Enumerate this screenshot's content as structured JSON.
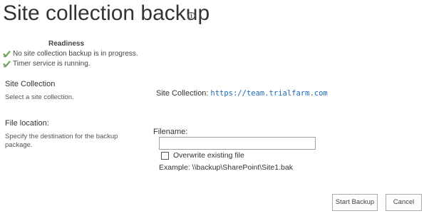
{
  "page": {
    "title": "Site collection backup",
    "info_icon": "info-icon"
  },
  "readiness": {
    "heading": "Readiness",
    "items": [
      {
        "icon": "check-icon",
        "text": "No site collection backup is in progress."
      },
      {
        "icon": "check-icon",
        "text": "Timer service is running."
      }
    ]
  },
  "site_collection": {
    "title": "Site Collection",
    "description": "Select a site collection.",
    "label": "Site Collection:",
    "value": "https://team.trialfarm.com"
  },
  "file_location": {
    "title": "File location:",
    "description_line1": "Specify the destination for the backup",
    "description_line2": "package.",
    "filename_label": "Filename:",
    "filename_value": "",
    "overwrite_label": "Overwrite existing file",
    "overwrite_checked": false,
    "example": "Example: \\\\backup\\SharePoint\\Site1.bak"
  },
  "buttons": {
    "start_label": "Start Backup",
    "cancel_label": "Cancel"
  },
  "colors": {
    "link": "#1f6bb5",
    "check_green": "#6aa84f"
  }
}
